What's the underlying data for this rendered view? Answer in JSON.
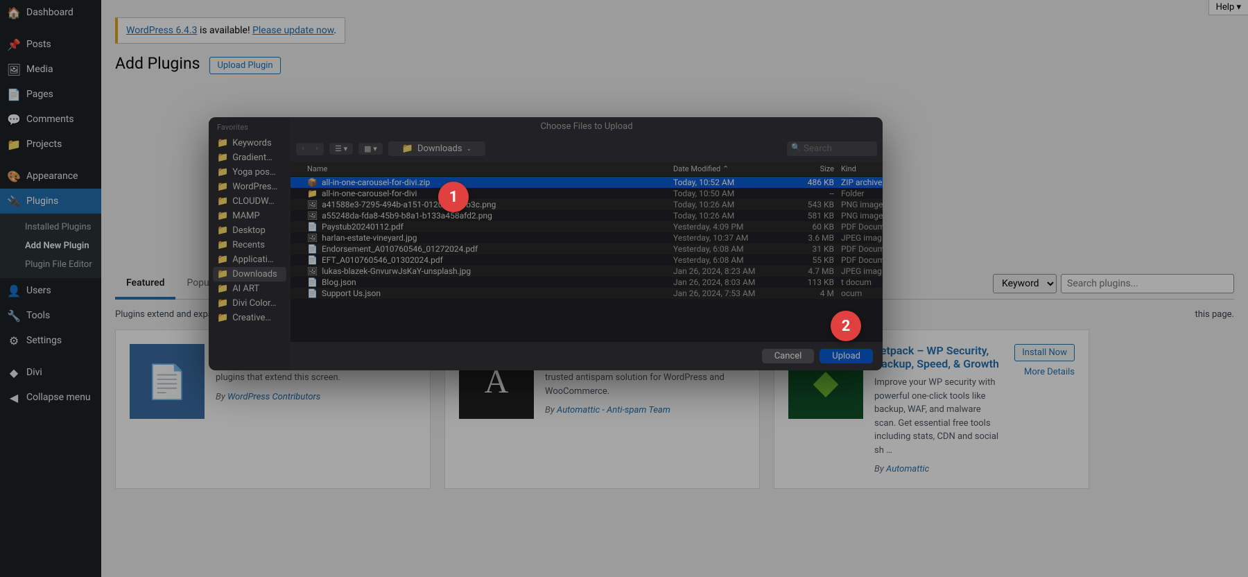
{
  "help": "Help",
  "sidebar": {
    "items": [
      {
        "label": "Dashboard",
        "icon": "🏠"
      },
      {
        "label": "Posts",
        "icon": "📌"
      },
      {
        "label": "Media",
        "icon": "🖼"
      },
      {
        "label": "Pages",
        "icon": "📄"
      },
      {
        "label": "Comments",
        "icon": "💬"
      },
      {
        "label": "Projects",
        "icon": "📁"
      },
      {
        "label": "Appearance",
        "icon": "🎨"
      },
      {
        "label": "Plugins",
        "icon": "🔌"
      },
      {
        "label": "Users",
        "icon": "👤"
      },
      {
        "label": "Tools",
        "icon": "🔧"
      },
      {
        "label": "Settings",
        "icon": "⚙"
      },
      {
        "label": "Divi",
        "icon": "◆"
      },
      {
        "label": "Collapse menu",
        "icon": "◀"
      }
    ],
    "submenu": [
      {
        "label": "Installed Plugins"
      },
      {
        "label": "Add New Plugin"
      },
      {
        "label": "Plugin File Editor"
      }
    ]
  },
  "notice": {
    "link1": "WordPress 6.4.3",
    "mid": " is available! ",
    "link2": "Please update now",
    "end": "."
  },
  "page": {
    "title": "Add Plugins",
    "upload_btn": "Upload Plugin"
  },
  "tabs": [
    "Featured",
    "Popular"
  ],
  "search": {
    "keyword": "Keyword",
    "placeholder": "Search plugins..."
  },
  "desc": {
    "start": "Plugins extend and expa",
    "end": " this page."
  },
  "plugin_cards": [
    {
      "desc": "\"classic\" editor and the old-style Edit Post screen with TinyMCE, Meta Boxes, etc.. Supports all plugins that extend this screen.",
      "by": "By ",
      "author": "WordPress Contributors",
      "thumb_bg": "#3a6ea5",
      "thumb_glyph": "📄"
    },
    {
      "desc": "The best anti-spam protection to block spam comments and spam in a contact form. The most trusted antispam solution for WordPress and WooCommerce.",
      "by": "By ",
      "author": "Automattic - Anti-spam Team",
      "thumb_bg": "#222",
      "thumb_glyph": "A"
    },
    {
      "title": "Jetpack – WP Security, Backup, Speed, & Growth",
      "desc": "Improve your WP security with powerful one-click tools like backup, WAF, and malware scan. Get essential free tools including stats, CDN and social sh …",
      "by": "By ",
      "author": "Automattic",
      "install": "Install Now",
      "more": "More Details",
      "thumb_bg": "#10552a",
      "thumb_glyph": "◆"
    }
  ],
  "dialog": {
    "title": "Choose Files to Upload",
    "favorites_label": "Favorites",
    "favorites": [
      "Keywords",
      "Gradient…",
      "Yoga pos…",
      "WordPres…",
      "CLOUDW…",
      "MAMP",
      "Desktop",
      "Recents",
      "Applicati…",
      "Downloads",
      "AI ART",
      "Divi Color…",
      "Creative…"
    ],
    "location": "Downloads",
    "search_placeholder": "Search",
    "columns": {
      "name": "Name",
      "date": "Date Modified",
      "size": "Size",
      "kind": "Kind"
    },
    "cancel": "Cancel",
    "upload": "Upload",
    "files": [
      {
        "icon": "📦",
        "name": "all-in-one-carousel-for-divi.zip",
        "date": "Today, 10:52 AM",
        "size": "486 KB",
        "kind": "ZIP archive",
        "selected": true
      },
      {
        "icon": "📁",
        "name": "all-in-one-carousel-for-divi",
        "date": "Today, 10:50 AM",
        "size": "--",
        "kind": "Folder"
      },
      {
        "icon": "🖼",
        "name": "a41588e3-7295-494b-a151-01205d070b3c.png",
        "date": "Today, 10:26 AM",
        "size": "543 KB",
        "kind": "PNG image"
      },
      {
        "icon": "🖼",
        "name": "a55248da-fda8-45b9-b8a1-b133a458afd2.png",
        "date": "Today, 10:26 AM",
        "size": "581 KB",
        "kind": "PNG image"
      },
      {
        "icon": "📄",
        "name": "Paystub20240112.pdf",
        "date": "Yesterday, 4:09 PM",
        "size": "60 KB",
        "kind": "PDF Docum"
      },
      {
        "icon": "🖼",
        "name": "harlan-estate-vineyard.jpg",
        "date": "Yesterday, 10:37 AM",
        "size": "3.6 MB",
        "kind": "JPEG imag"
      },
      {
        "icon": "📄",
        "name": "Endorsement_A010760546_01272024.pdf",
        "date": "Yesterday, 6:08 AM",
        "size": "31 KB",
        "kind": "PDF Docum"
      },
      {
        "icon": "📄",
        "name": "EFT_A010760546_01302024.pdf",
        "date": "Yesterday, 6:08 AM",
        "size": "55 KB",
        "kind": "PDF Docum"
      },
      {
        "icon": "🖼",
        "name": "lukas-blazek-GnvurwJsKaY-unsplash.jpg",
        "date": "Jan 26, 2024, 8:23 AM",
        "size": "4.7 MB",
        "kind": "JPEG imag"
      },
      {
        "icon": "📄",
        "name": "Blog.json",
        "date": "Jan 26, 2024, 8:03 AM",
        "size": "113 KB",
        "kind": "t docum"
      },
      {
        "icon": "📄",
        "name": "Support Us.json",
        "date": "Jan 26, 2024, 7:53 AM",
        "size": "4 M",
        "kind": "ocum"
      }
    ]
  },
  "annotations": [
    "1",
    "2"
  ]
}
